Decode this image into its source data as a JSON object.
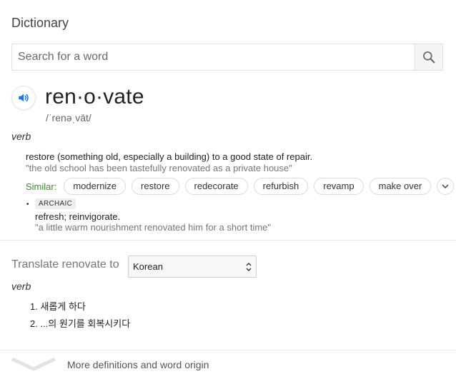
{
  "header": {
    "title": "Dictionary"
  },
  "search": {
    "placeholder": "Search for a word",
    "value": ""
  },
  "entry": {
    "word": "ren·o·vate",
    "phonetic": "/ˈrenəˌvāt/",
    "part_of_speech": "verb",
    "senses": [
      {
        "definition": "restore (something old, especially a building) to a good state of repair.",
        "example": "\"the old school has been tastefully renovated as a private house\"",
        "similar_label": "Similar:",
        "similar": [
          "modernize",
          "restore",
          "redecorate",
          "refurbish",
          "revamp",
          "make over"
        ]
      },
      {
        "tag": "ARCHAIC",
        "definition": "refresh; reinvigorate.",
        "example": "\"a little warm nourishment renovated him for a short time\""
      }
    ]
  },
  "translate": {
    "label": "Translate renovate to",
    "language": "Korean",
    "part_of_speech": "verb",
    "items": [
      "1. 새롭게 하다",
      "2. ...의 원기를 회복시키다"
    ]
  },
  "footer": {
    "more_label": "More definitions and word origin"
  },
  "icons": {
    "search": "search-icon",
    "speaker": "speaker-icon",
    "expand": "chevron-down-icon",
    "select_arrows": "select-arrows-icon",
    "footer": "chevron-down-icon"
  },
  "colors": {
    "accent_blue": "#1a73e8",
    "similar_green": "#3c8d2f"
  }
}
